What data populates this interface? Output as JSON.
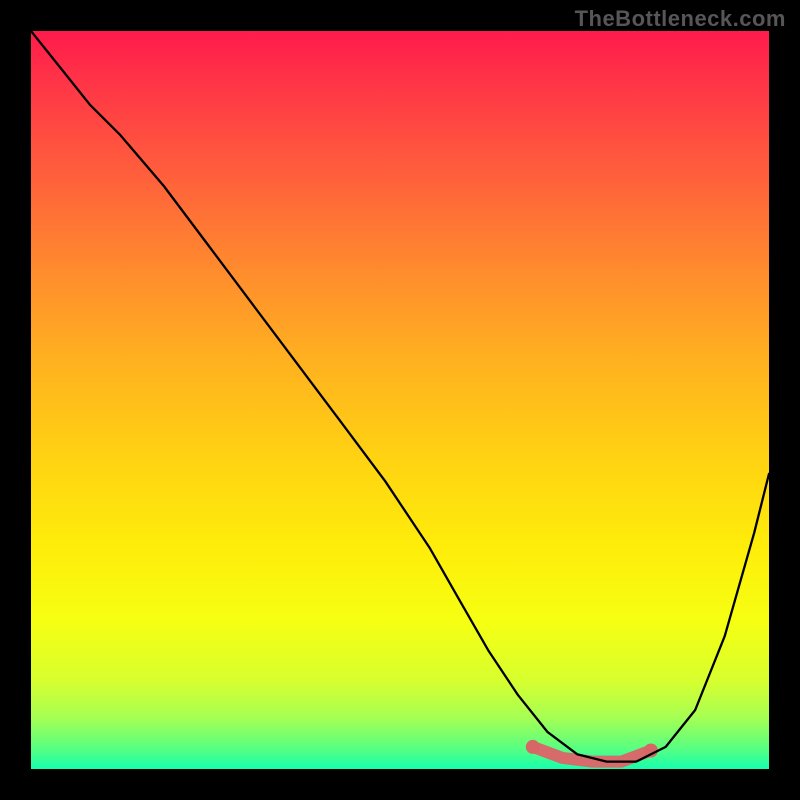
{
  "watermark": "TheBottleneck.com",
  "chart_data": {
    "type": "line",
    "title": "",
    "xlabel": "",
    "ylabel": "",
    "xlim": [
      0,
      100
    ],
    "ylim": [
      0,
      100
    ],
    "grid": false,
    "legend": false,
    "background_gradient": {
      "top_color": "#ff1b4c",
      "bottom_color": "#17ffad",
      "note": "Vertical rainbow gradient (red at top through orange, yellow, green at bottom) representing bottleneck severity; lower y = better."
    },
    "series": [
      {
        "name": "bottleneck-curve",
        "color": "#000000",
        "x": [
          0,
          4,
          8,
          12,
          18,
          24,
          30,
          36,
          42,
          48,
          54,
          58,
          62,
          66,
          70,
          74,
          78,
          82,
          86,
          90,
          94,
          98,
          100
        ],
        "y": [
          100,
          95,
          90,
          86,
          79,
          71,
          63,
          55,
          47,
          39,
          30,
          23,
          16,
          10,
          5,
          2,
          1,
          1,
          3,
          8,
          18,
          32,
          40
        ]
      }
    ],
    "highlight_region": {
      "name": "optimal-range",
      "color": "#d76a6a",
      "x": [
        68,
        72,
        76,
        80,
        84
      ],
      "y": [
        3,
        1.5,
        1,
        1,
        2.5
      ],
      "note": "Thick salmon segment marking the valley floor (minimum bottleneck zone)."
    }
  }
}
